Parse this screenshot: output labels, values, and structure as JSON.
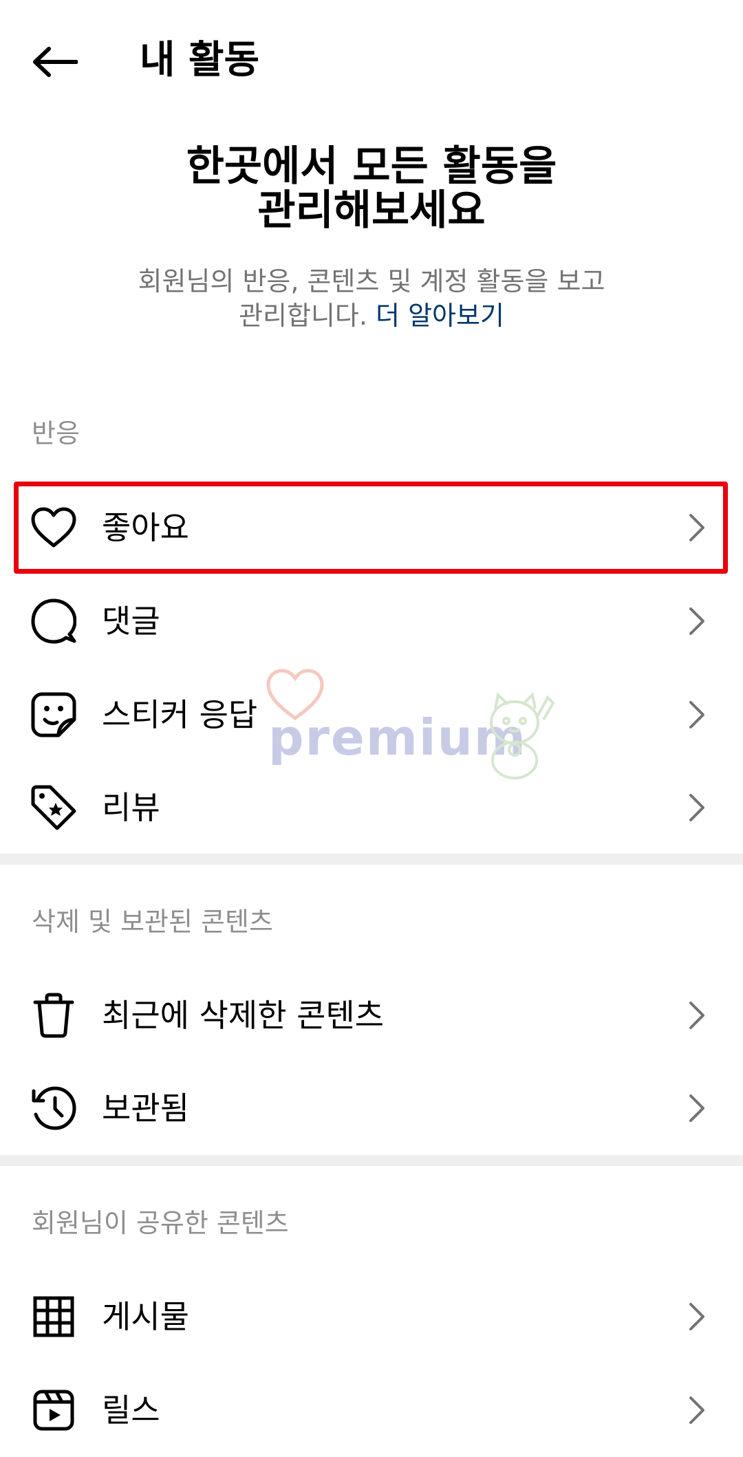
{
  "header": {
    "title": "내 활동",
    "back_icon": "arrow-left-icon"
  },
  "hero": {
    "title_line1": "한곳에서 모든 활동을",
    "title_line2": "관리해보세요",
    "desc_line1": "회원님의 반응, 콘텐츠 및 계정 활동을 보고",
    "desc_line2_prefix": "관리합니다.",
    "learn_more": "더 알아보기"
  },
  "sections": {
    "reactions": {
      "header": "반응",
      "items": [
        {
          "label": "좋아요",
          "icon": "heart-icon"
        },
        {
          "label": "댓글",
          "icon": "comment-bubble-icon"
        },
        {
          "label": "스티커 응답",
          "icon": "sticker-icon"
        },
        {
          "label": "리뷰",
          "icon": "tag-star-icon"
        }
      ]
    },
    "deleted_archived": {
      "header": "삭제 및 보관된 콘텐츠",
      "items": [
        {
          "label": "최근에 삭제한 콘텐츠",
          "icon": "trash-icon"
        },
        {
          "label": "보관됨",
          "icon": "archive-history-icon"
        }
      ]
    },
    "shared": {
      "header": "회원님이 공유한 콘텐츠",
      "items": [
        {
          "label": "게시물",
          "icon": "grid-icon"
        },
        {
          "label": "릴스",
          "icon": "reels-icon"
        }
      ]
    }
  },
  "watermark": {
    "text": "premium"
  },
  "colors": {
    "highlight": "#e8000b",
    "link": "#00376b",
    "secondary_text": "#8e8e8e",
    "divider": "#efefef"
  }
}
